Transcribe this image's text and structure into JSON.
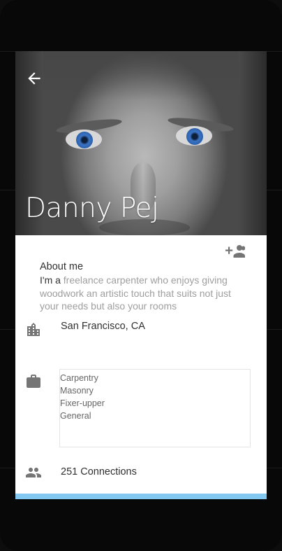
{
  "profile": {
    "name": "Danny Pej",
    "about_title": "About me",
    "about_lead": "I'm a",
    "about_body": " freelance carpenter who enjoys giving woodwork an artistic touch that suits not just your needs but also your rooms",
    "location": "San Francisco, CA",
    "skills": [
      "Carpentry",
      "Masonry",
      "Fixer-upper",
      "General"
    ],
    "connections": "251 Connections"
  },
  "icons": {
    "back": "arrow-left-icon",
    "add_person": "person-add-icon",
    "location": "city-icon",
    "work": "briefcase-icon",
    "connections": "people-icon"
  },
  "colors": {
    "text_primary": "#2f2f2f",
    "text_secondary": "#9e9e9e",
    "icon_gray": "#757575",
    "accent_bar": "#82c8f0"
  }
}
